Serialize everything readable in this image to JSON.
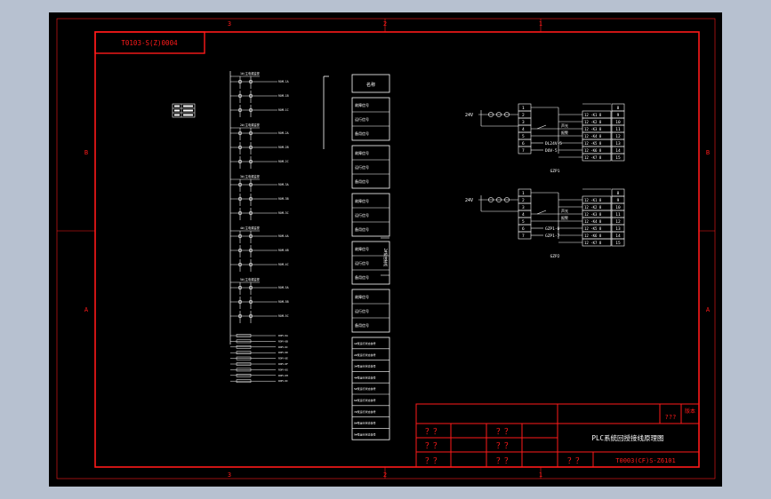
{
  "colors": {
    "background": "#b7c1d0",
    "sheet": "#000000",
    "frame": "#ff1a1a",
    "linework": "#ffffff",
    "text_red": "#ff1a1a",
    "text_white": "#ffffff"
  },
  "sheet": {
    "top_id": "T0103-S(Z)0004",
    "zone_cols": [
      "3",
      "2",
      "1"
    ],
    "zone_rows": [
      "B",
      "A"
    ],
    "title_block": {
      "drawing_title": "PLC系统回授接线原理图",
      "drawing_number": "T0003(CF)S-Z6101",
      "corner_label": "版本",
      "corner_marks": "???",
      "placeholder": "？？"
    }
  },
  "left_legend_rows": [
    "SA1-1",
    "SA2-2",
    "SA3-3"
  ],
  "bus_groups": [
    {
      "label": "1#/主电源监视",
      "rows": [
        "ROM-1A",
        "ROM-1B",
        "ROM-1C"
      ]
    },
    {
      "label": "2#/主电源监视",
      "rows": [
        "ROM-2A",
        "ROM-2B",
        "ROM-2C"
      ]
    },
    {
      "label": "3#/主电源监视",
      "rows": [
        "ROM-3A",
        "ROM-3B",
        "ROM-3C"
      ]
    },
    {
      "label": "4#/主电源监视",
      "rows": [
        "ROM-4A",
        "ROM-4B",
        "ROM-4C"
      ]
    },
    {
      "label": "5#/主电源监视",
      "rows": [
        "ROM-5A",
        "ROM-5B",
        "ROM-5C"
      ]
    }
  ],
  "bus_bottom_rows": [
    "ROM-6A",
    "ROM-6B",
    "ROM-6C",
    "ROM-6D",
    "ROM-6E",
    "ROM-6F",
    "ROM-6G",
    "ROM-6H",
    "ROM-6I"
  ],
  "signal_table": {
    "header": "名称",
    "groups": [
      [
        "故障信号",
        "运行信号",
        "备用信号"
      ],
      [
        "故障信号",
        "运行信号",
        "备用信号"
      ],
      [
        "故障信号",
        "运行信号",
        "备用信号"
      ],
      [
        "故障信号",
        "运行信号",
        "备用信号"
      ],
      [
        "故障信号",
        "运行信号",
        "备用信号"
      ]
    ],
    "side_note": "2#泵控制柜",
    "bottom_rows": [
      "1#泵运行状态信号",
      "2#泵运行状态信号",
      "3#泵运行状态信号",
      "4#泵运行状态信号",
      "5#泵运行状态信号",
      "6#泵运行状态信号",
      "7#泵运行状态信号",
      "8#泵运行状态信号",
      "9#泵运行状态信号"
    ]
  },
  "circuits": [
    {
      "name": "GZP1",
      "supply": "24V",
      "terminals": [
        "1",
        "2",
        "3",
        "4",
        "5",
        "6",
        "7"
      ],
      "labels": [
        "DL24V-5",
        "DOV-5"
      ],
      "note": "声光\n报警",
      "right_terminals": [
        "8",
        "9",
        "10",
        "11",
        "12",
        "13",
        "14",
        "15"
      ],
      "relays": [
        "12 -K1 8",
        "12 -K2 8",
        "12 -K3 8",
        "12 -K4 8",
        "12 -K5 8",
        "12 -K6 8",
        "12 -K7 8"
      ]
    },
    {
      "name": "GZP2",
      "supply": "24V",
      "terminals": [
        "1",
        "2",
        "3",
        "4",
        "5",
        "6",
        "7"
      ],
      "labels": [
        "GZP1-6",
        "GZP1-7"
      ],
      "note": "声光\n报警",
      "right_terminals": [
        "8",
        "9",
        "10",
        "11",
        "12",
        "13",
        "14",
        "15"
      ],
      "relays": [
        "12 -K1 8",
        "12 -K2 8",
        "12 -K3 8",
        "12 -K4 8",
        "12 -K5 8",
        "12 -K6 8",
        "12 -K7 8"
      ]
    }
  ]
}
